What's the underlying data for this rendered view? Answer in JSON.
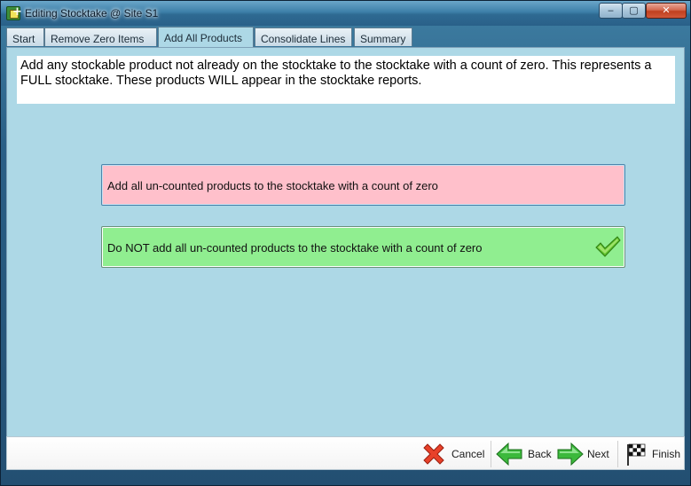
{
  "window": {
    "title": "Editing Stocktake @ Site S1",
    "controls": {
      "minimize": "‒",
      "maximize": "▢",
      "close": "✕"
    }
  },
  "tabs": [
    {
      "label": "Start"
    },
    {
      "label": "Remove Zero Items"
    },
    {
      "label": "Add All Products",
      "active": true
    },
    {
      "label": "Consolidate Lines"
    },
    {
      "label": "Summary"
    }
  ],
  "info": {
    "text": "Add any stockable product not already on the stocktake to the stocktake with a count of zero.  This represents a FULL stocktake.  These products WILL appear in the stocktake reports."
  },
  "options": {
    "add": {
      "label": "Add all un-counted products to the stocktake with a count of zero",
      "color": "#ffc0cb"
    },
    "do_not_add": {
      "label": "Do NOT add all un-counted products to the stocktake with a count of zero",
      "color": "#90ee90",
      "selected": true,
      "icon": "checkmark-icon"
    }
  },
  "footer": {
    "cancel": "Cancel",
    "back": "Back",
    "next": "Next",
    "finish": "Finish"
  },
  "colors": {
    "content_bg": "#add8e6",
    "titlebar": "#3d7fa8"
  }
}
